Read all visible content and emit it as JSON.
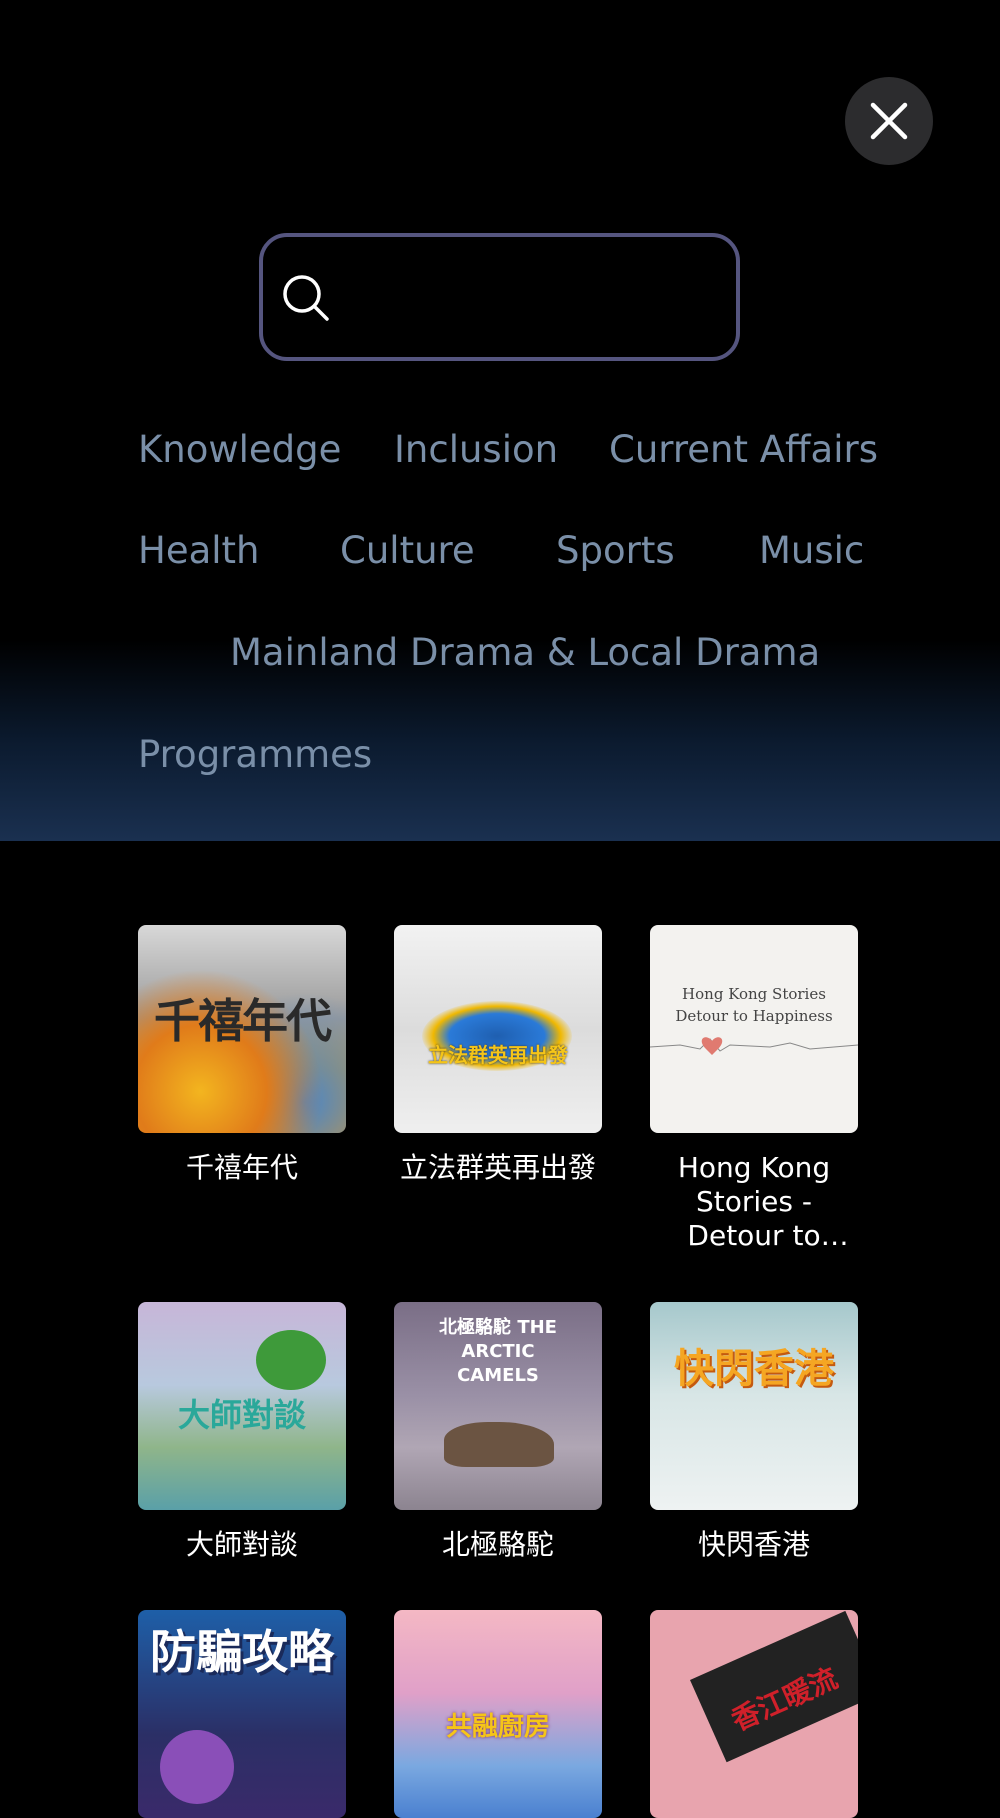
{
  "search": {
    "placeholder": ""
  },
  "categories": [
    "Knowledge",
    "Inclusion",
    "Current Affairs",
    "Health",
    "Culture",
    "Sports",
    "Music",
    "Mainland Drama & Local Drama"
  ],
  "section_title": "Programmes",
  "programmes": [
    {
      "title": "千禧年代",
      "thumb_text": "千禧年代"
    },
    {
      "title": "立法群英再出發",
      "thumb_text": "立法群英再出發"
    },
    {
      "title": "Hong Kong Stories - Detour to Happiness",
      "thumb_text": "Hong Kong Stories Detour to Happiness"
    },
    {
      "title": "大師對談",
      "thumb_text": "大師對談"
    },
    {
      "title": "北極駱駝",
      "thumb_text": "北極駱駝 THE ARCTIC CAMELS"
    },
    {
      "title": "快閃香港",
      "thumb_text": "快閃香港"
    },
    {
      "title": "",
      "thumb_text": "防騙攻略"
    },
    {
      "title": "",
      "thumb_text": "共融廚房"
    },
    {
      "title": "",
      "thumb_text": "香江暖流"
    }
  ],
  "colors": {
    "category_text": "#7a8fa8",
    "search_border": "#55557f",
    "close_bg": "#2c2c2e"
  }
}
